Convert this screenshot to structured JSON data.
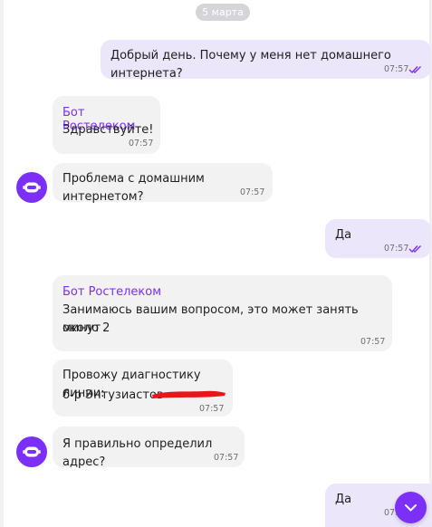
{
  "date_divider": "5 марта",
  "colors": {
    "accent": "#7b2ff7",
    "incoming_bubble": "#f2f2f3",
    "outgoing_bubble": "#ece6fb"
  },
  "messages": [
    {
      "direction": "out",
      "text": "Добрый день. Почему у меня нет домашнего интернета?",
      "time": "07:57",
      "status": "read"
    },
    {
      "direction": "in",
      "sender": "Бот Ростелеком",
      "text": "Здравствуйте!",
      "time": "07:57"
    },
    {
      "direction": "in",
      "text": "Проблема с домашним интернетом?",
      "time": "07:57",
      "avatar": "robot-icon"
    },
    {
      "direction": "out",
      "text": "Да",
      "time": "07:57",
      "status": "read"
    },
    {
      "direction": "in",
      "sender": "Бот Ростелеком",
      "text_line1": "Занимаюсь вашим вопросом, это может занять около 2",
      "text_line2": "минут",
      "time": "07:57"
    },
    {
      "direction": "in",
      "text_line1": "Провожу диагностику линии:",
      "text_line2": "б-р Энтузиастов",
      "time": "07:57"
    },
    {
      "direction": "in",
      "text": "Я правильно определил адрес?",
      "time": "07:57",
      "avatar": "robot-icon"
    },
    {
      "direction": "out",
      "text": "Да",
      "time": "07:5",
      "status": "read"
    }
  ],
  "scroll_button_icon": "chevron-down-icon"
}
